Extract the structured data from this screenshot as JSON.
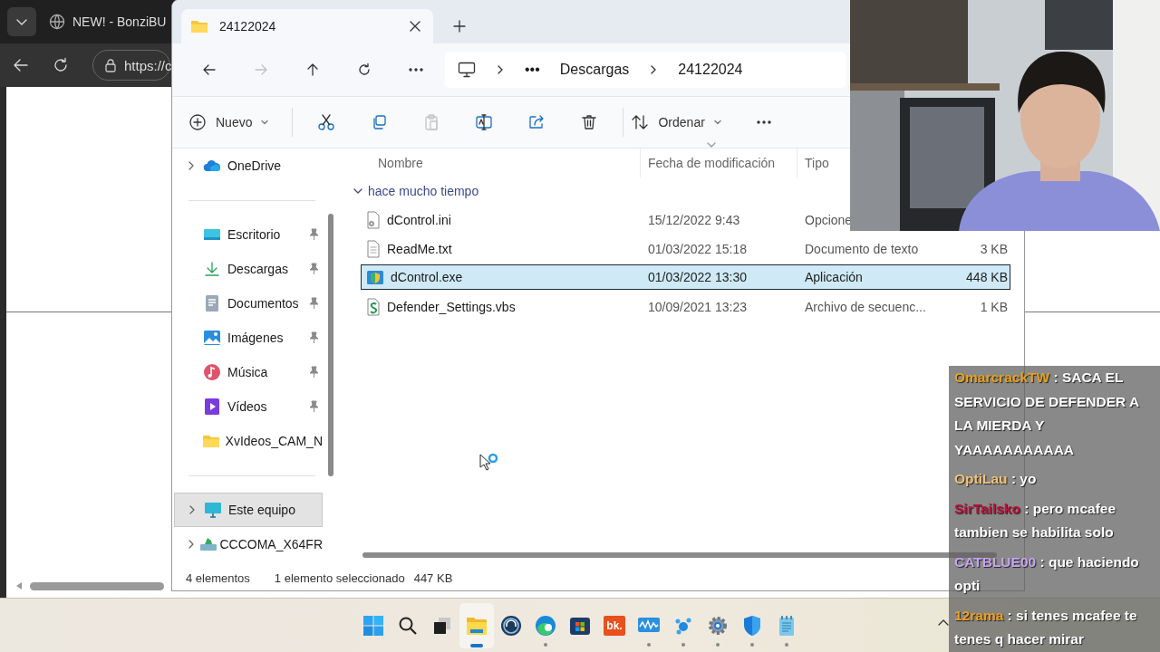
{
  "browser": {
    "tab": {
      "title": "NEW! - BonziBU"
    },
    "address": "https://c"
  },
  "explorer": {
    "tabs": [
      {
        "label": "24122024",
        "selected": true
      }
    ],
    "nav_buttons": [
      {
        "kind": "back",
        "disabled": false
      },
      {
        "kind": "forward",
        "disabled": true
      },
      {
        "kind": "up",
        "disabled": false
      },
      {
        "kind": "refresh",
        "disabled": false
      },
      {
        "kind": "more",
        "disabled": false
      }
    ],
    "breadcrumb": {
      "overflow": "•••",
      "items": [
        "Descargas",
        "24122024"
      ]
    },
    "commands": [
      {
        "kind": "new",
        "label": "Nuevo",
        "disabled": false
      },
      {
        "kind": "cut",
        "disabled": false
      },
      {
        "kind": "copy",
        "disabled": false
      },
      {
        "kind": "paste",
        "disabled": true
      },
      {
        "kind": "rename",
        "disabled": false
      },
      {
        "kind": "share",
        "disabled": false
      },
      {
        "kind": "delete",
        "disabled": false
      },
      {
        "kind": "sort",
        "label": "Ordenar",
        "disabled": false
      },
      {
        "kind": "more",
        "disabled": false
      }
    ],
    "sidebar": {
      "sections": [
        {
          "items": [
            {
              "label": "OneDrive",
              "kind": "onedrive",
              "expanded": false,
              "pinned": false,
              "selected": false
            }
          ]
        },
        {
          "items": [
            {
              "label": "Escritorio",
              "kind": "desktop",
              "pinned": true,
              "selected": false
            },
            {
              "label": "Descargas",
              "kind": "download",
              "pinned": true,
              "selected": false
            },
            {
              "label": "Documentos",
              "kind": "documents",
              "pinned": true,
              "selected": false
            },
            {
              "label": "Imágenes",
              "kind": "pictures",
              "pinned": true,
              "selected": false
            },
            {
              "label": "Música",
              "kind": "music",
              "pinned": true,
              "selected": false
            },
            {
              "label": "Vídeos",
              "kind": "videos",
              "pinned": true,
              "selected": false
            },
            {
              "label": "XvIdeos_CAM_N",
              "kind": "folder",
              "pinned": false,
              "selected": false
            }
          ]
        },
        {
          "items": [
            {
              "label": "Este equipo",
              "kind": "computer",
              "expanded": false,
              "pinned": false,
              "selected": true
            },
            {
              "label": "CCCOMA_X64FR",
              "kind": "drive",
              "expanded": false,
              "pinned": false,
              "selected": false
            }
          ]
        }
      ]
    },
    "columns": [
      {
        "label": "Nombre",
        "sorted": false
      },
      {
        "label": "Fecha de modificación",
        "sorted": true
      },
      {
        "label": "Tipo",
        "sorted": false
      }
    ],
    "groups": [
      {
        "label": "hace mucho tiempo",
        "expanded": true,
        "files": [
          {
            "name": "dControl.ini",
            "kind": "ini",
            "date": "15/12/2022 9:43",
            "type": "Opcione",
            "selected": false
          },
          {
            "name": "ReadMe.txt",
            "kind": "txt",
            "date": "01/03/2022 15:18",
            "type": "Documento de texto",
            "size": "3 KB",
            "selected": false
          },
          {
            "name": "dControl.exe",
            "kind": "exe",
            "date": "01/03/2022 13:30",
            "type": "Aplicación",
            "size": "448 KB",
            "selected": true
          },
          {
            "name": "Defender_Settings.vbs",
            "kind": "vbs",
            "date": "10/09/2021 13:23",
            "type": "Archivo de secuenc...",
            "size": "1 KB",
            "selected": false
          }
        ]
      }
    ],
    "status": {
      "count": "4 elementos",
      "selection": "1 elemento seleccionado",
      "size": "447 KB"
    }
  },
  "chat": {
    "messages": [
      {
        "user": "OmarcrackTW",
        "color": "#e8a21a",
        "text": ": SACA EL SERVICIO DE DEFENDER A LA MIERDA Y YAAAAAAAAAAA"
      },
      {
        "user": "OptiLau",
        "color": "#f0c27a",
        "text": ": yo"
      },
      {
        "user": "SirTailsko",
        "color": "#c0103a",
        "text": ": pero mcafee tambien se habilita solo"
      },
      {
        "user": "CATBLUE00",
        "color": "#c9a4f2",
        "text": ": que haciendo opti"
      },
      {
        "user": "12rama",
        "color": "#f0a020",
        "text": ": si tenes mcafee te tenes q hacer mirar"
      }
    ]
  },
  "taskbar": {
    "items": [
      {
        "kind": "start",
        "running": false,
        "active": false
      },
      {
        "kind": "search",
        "running": false,
        "active": false
      },
      {
        "kind": "taskview",
        "running": false,
        "active": false
      },
      {
        "kind": "explorer",
        "running": true,
        "active": true
      },
      {
        "kind": "headset",
        "running": false,
        "active": false
      },
      {
        "kind": "edge",
        "running": true,
        "active": false
      },
      {
        "kind": "store",
        "running": false,
        "active": false
      },
      {
        "kind": "bk",
        "label": "bk.",
        "running": false,
        "active": false
      },
      {
        "kind": "waves",
        "running": true,
        "active": false
      },
      {
        "kind": "molecule",
        "running": true,
        "active": false
      },
      {
        "kind": "settings",
        "running": true,
        "active": false
      },
      {
        "kind": "security",
        "running": true,
        "active": false
      },
      {
        "kind": "notepad",
        "running": true,
        "active": false
      }
    ]
  }
}
